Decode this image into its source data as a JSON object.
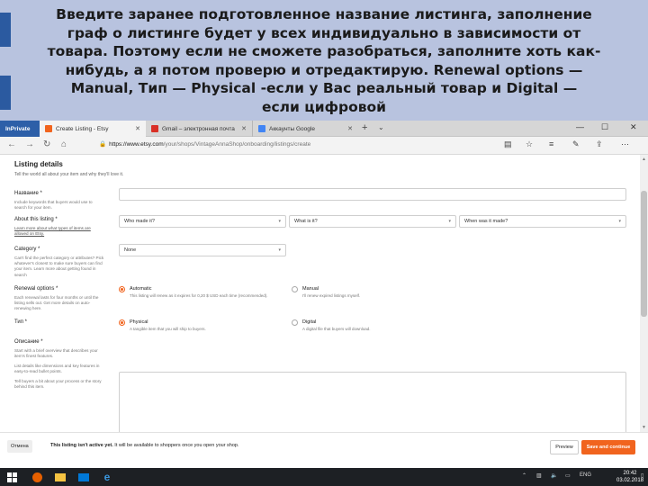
{
  "caption": {
    "lines": [
      "Введите заранее подготовленное название листинга, заполнение",
      "граф о листинге будет у всех индивидуально в зависимости от",
      "товара. Поэтому если не сможете разобраться, заполните хоть как-",
      "нибудь, а я потом проверю и отредактирую. Renewal options —",
      "Manual, Тип — Physical -если у Вас реальный товар и Digital —",
      "если цифровой"
    ]
  },
  "browser": {
    "tabs": [
      {
        "label": "InPrivate"
      },
      {
        "label": "Create Listing - Etsy"
      },
      {
        "label": "Gmail – электронная почта"
      },
      {
        "label": "Аккаунты Google"
      }
    ],
    "url_host": "https://www.etsy.com",
    "url_path": "/your/shops/VintageAnnaShop/onboarding/listings/create"
  },
  "form": {
    "heading": "Listing details",
    "subheading": "Tell the world all about your item and why they'll love it.",
    "title_label": "Название *",
    "title_help": "Include keywords that buyers would use to search for your item.",
    "about_label": "About this listing *",
    "about_help": "Learn more about what types of items are allowed on Etsy.",
    "about_selects": [
      "Who made it?",
      "What is it?",
      "When was it made?"
    ],
    "category_label": "Category *",
    "category_help": "Can't find the perfect category or attributes? Pick whatever's closest to make sure buyers can find your item. Learn more about getting found in search",
    "category_value": "None",
    "renewal_label": "Renewal options *",
    "renewal_help": "Each renewal lasts for four months or until the listing sells out. Get more details on auto-renewing here.",
    "renewal_auto": "Automatic",
    "renewal_auto_desc": "This listing will renew as it expires for 0,20 $ USD each time (recommended).",
    "renewal_manual": "Manual",
    "renewal_manual_desc": "I'll renew expired listings myself.",
    "type_label": "Тип *",
    "type_physical": "Physical",
    "type_physical_desc": "A tangible item that you will ship to buyers.",
    "type_digital": "Digital",
    "type_digital_desc": "A digital file that buyers will download.",
    "desc_label": "Описание *",
    "desc_help": [
      "Start with a brief overview that describes your item's finest features.",
      "List details like dimensions and key features in easy-to-read bullet points.",
      "Tell buyers a bit about your process or the story behind this item."
    ]
  },
  "footer": {
    "cancel": "Отмена",
    "notice_bold": "This listing isn't active yet.",
    "notice_rest": " It will be available to shoppers once you open your shop.",
    "preview": "Preview",
    "save": "Save and continue"
  },
  "taskbar": {
    "lang": "ENG",
    "time": "20:42",
    "date": "03.02.2018"
  },
  "colors": {
    "accent": "#f1641e",
    "caption_bg": "#b8c3df",
    "inprivate": "#2d5fa8"
  }
}
